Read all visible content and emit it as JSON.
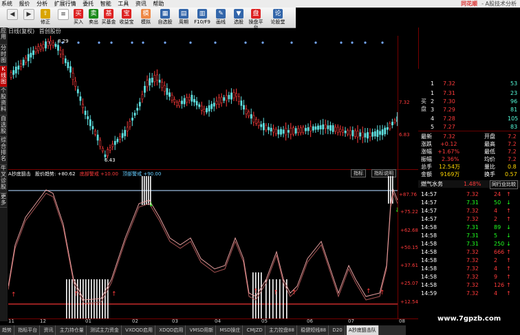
{
  "menu": [
    "系统",
    "报价",
    "分析",
    "扩展行情",
    "委托",
    "智能",
    "工具",
    "资讯",
    "帮助"
  ],
  "app": {
    "logo": "同花顺",
    "title": "- A股技术分析"
  },
  "toolbar": [
    "修正",
    "买入",
    "卖出",
    "买基金",
    "收益宝",
    "模拟",
    "自选股",
    "周期",
    "F10/F9",
    "画线",
    "选股",
    "操盘平台",
    "论股堂"
  ],
  "sidetabs": [
    "应用",
    "分时图",
    "K线图",
    "个股资料",
    "自选股",
    "综合排名",
    "牛叉诊股",
    "更多"
  ],
  "header": {
    "period": "日线(复权)",
    "name": "首创股份"
  },
  "price_panel": {
    "high_label": "8.29",
    "low_label": "6.43",
    "right_ticks": [
      "7.32",
      "6.83"
    ],
    "colors": {
      "up": "#ff3b3b",
      "down": "#5fe0e0"
    }
  },
  "indicator": {
    "name": "A抄底狙击",
    "labels": [
      "股价趋势: +80.62",
      "底部警戒 +10.00",
      "顶部警戒 +90.00"
    ],
    "tabs": [
      "指标",
      "指标说明"
    ],
    "ticks": [
      "+87.76",
      "+75.22",
      "+62.68",
      "+50.15",
      "+37.61",
      "+25.07",
      "+12.54"
    ]
  },
  "xaxis": [
    "11",
    "12",
    "01",
    "02",
    "03",
    "04",
    "05",
    "06",
    "07",
    "08"
  ],
  "statusbar": [
    "趋势",
    "指标平台",
    "资讯",
    "主力持仓量",
    "测试主力资金",
    "VXDQD启用",
    "XDQD启用",
    "VMSD用新",
    "MSD操庄",
    "CMJZD",
    "主力控盘88",
    "稳健短线88",
    "D20",
    "A抄底狙击队"
  ],
  "orderbook": {
    "sell_label": "卖盘",
    "buy_label": "买盘",
    "rows": [
      {
        "lv": "1",
        "price": "7.32",
        "vol": "53"
      },
      {
        "lv": "1",
        "price": "7.31",
        "vol": "23"
      },
      {
        "lv": "2",
        "price": "7.30",
        "vol": "96"
      },
      {
        "lv": "3",
        "price": "7.29",
        "vol": "81"
      },
      {
        "lv": "4",
        "price": "7.28",
        "vol": "105"
      },
      {
        "lv": "5",
        "price": "7.27",
        "vol": "83"
      }
    ]
  },
  "quote": [
    {
      "l1": "最新",
      "v1": "7.32",
      "l2": "开盘",
      "v2": "7.2"
    },
    {
      "l1": "涨跌",
      "v1": "+0.12",
      "l2": "最高",
      "v2": "7.2"
    },
    {
      "l1": "涨幅",
      "v1": "+1.67%",
      "l2": "最低",
      "v2": "7.2"
    },
    {
      "l1": "振幅",
      "v1": "2.36%",
      "l2": "均价",
      "v2": "7.2"
    },
    {
      "l1": "总手",
      "v1": "12.54万",
      "l2": "量比",
      "v2": "0.8"
    },
    {
      "l1": "金额",
      "v1": "9169万",
      "l2": "换手",
      "v2": "0.57"
    }
  ],
  "sector": {
    "name": "燃气水务",
    "pct": "1.48%",
    "btn": "同行业比较"
  },
  "ticks": [
    {
      "t": "14:57",
      "p": "7.32",
      "v": "24"
    },
    {
      "t": "14:57",
      "p": "7.31",
      "v": "50"
    },
    {
      "t": "14:57",
      "p": "7.32",
      "v": "4"
    },
    {
      "t": "14:57",
      "p": "7.32",
      "v": "2"
    },
    {
      "t": "14:58",
      "p": "7.31",
      "v": "89"
    },
    {
      "t": "14:58",
      "p": "7.31",
      "v": "5"
    },
    {
      "t": "14:58",
      "p": "7.31",
      "v": "250"
    },
    {
      "t": "14:58",
      "p": "7.32",
      "v": "666"
    },
    {
      "t": "14:58",
      "p": "7.32",
      "v": "2"
    },
    {
      "t": "14:58",
      "p": "7.32",
      "v": "4"
    },
    {
      "t": "14:58",
      "p": "7.32",
      "v": "9"
    },
    {
      "t": "14:58",
      "p": "7.32",
      "v": "126"
    },
    {
      "t": "14:59",
      "p": "7.32",
      "v": "4"
    }
  ],
  "watermark": "www.7gpzb.com"
}
